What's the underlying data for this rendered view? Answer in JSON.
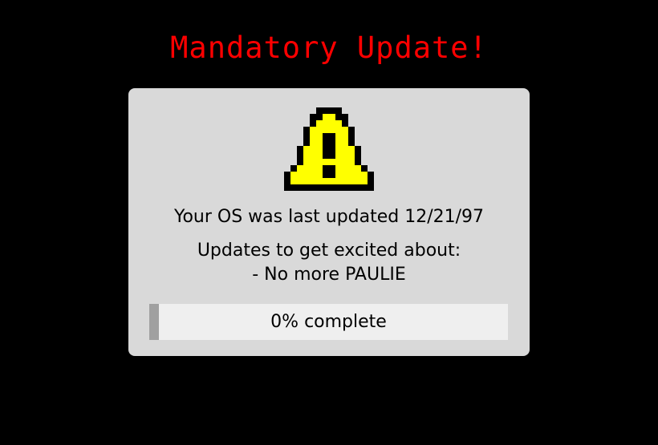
{
  "title": "Mandatory Update!",
  "dialog": {
    "icon": "warning-triangle-icon",
    "last_updated_text": "Your OS was last updated 12/21/97",
    "updates_heading": "Updates to get excited about:",
    "update_items": [
      "- No more PAULIE"
    ],
    "progress": {
      "value_percent": 0,
      "label": "0% complete"
    }
  },
  "colors": {
    "background": "#000000",
    "title": "#ff0000",
    "dialog_background": "#d9d9d9",
    "icon_fill": "#ffff00",
    "progress_track": "#efefef",
    "progress_fill": "#a0a0a0"
  }
}
